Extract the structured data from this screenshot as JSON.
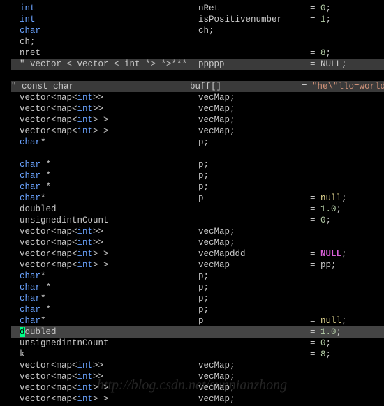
{
  "watermark": "http://blog.csdn.net/sunnianzhong",
  "code_lines": [
    {
      "decl_type": "int",
      "decl_rest": "",
      "var": "nRet",
      "assign": true,
      "val": "0",
      "val_kind": "num",
      "hl": false
    },
    {
      "decl_type": "int",
      "decl_rest": "",
      "var": "isPositivenumber",
      "assign": true,
      "val": "1",
      "val_kind": "num",
      "hl": false
    },
    {
      "decl_type": "char",
      "decl_rest": "",
      "var": "ch;",
      "assign": false,
      "val": "",
      "val_kind": "",
      "hl": false
    },
    {
      "decl_type": "",
      "decl_rest": "ch;",
      "var": "",
      "assign": false,
      "val": "",
      "val_kind": "",
      "hl": false
    },
    {
      "decl_type": "",
      "decl_rest": "nret",
      "var": "",
      "assign": true,
      "val": "8",
      "val_kind": "num",
      "hl": false,
      "no_var_col": true
    },
    {
      "decl_type": "",
      "decl_rest": "\" vector < vector < int *> *>***",
      "var": "ppppp",
      "assign": true,
      "val": "NULL",
      "val_kind": "plain",
      "hl": true
    },
    {
      "blank": true
    },
    {
      "decl_type": "",
      "decl_rest": "\" const char",
      "var": "buff[]",
      "assign": true,
      "val": "\"he\\\"llo=world\"",
      "val_kind": "str",
      "hl": true
    },
    {
      "decl_type": "",
      "decl_rest": "vector<map<int>>",
      "inner_kw": "int",
      "var": "vecMap;",
      "assign": false,
      "val": "",
      "val_kind": "",
      "hl": false
    },
    {
      "decl_type": "",
      "decl_rest": "vector<map<int>>",
      "inner_kw": "int",
      "var": "vecMap;",
      "assign": false,
      "val": "",
      "val_kind": "",
      "hl": false
    },
    {
      "decl_type": "",
      "decl_rest": "vector<map<int> >",
      "inner_kw": "int",
      "var": "vecMap;",
      "assign": false,
      "val": "",
      "val_kind": "",
      "hl": false
    },
    {
      "decl_type": "",
      "decl_rest": "vector<map<int> >",
      "inner_kw": "int",
      "var": "vecMap;",
      "assign": false,
      "val": "",
      "val_kind": "",
      "hl": false
    },
    {
      "decl_type": "char",
      "decl_rest": "*",
      "var": "p;",
      "assign": false,
      "val": "",
      "val_kind": "",
      "hl": false
    },
    {
      "blank": true
    },
    {
      "decl_type": "char",
      "decl_rest": " *",
      "var": "p;",
      "assign": false,
      "val": "",
      "val_kind": "",
      "hl": false
    },
    {
      "decl_type": "char",
      "decl_rest": " *",
      "var": "p;",
      "assign": false,
      "val": "",
      "val_kind": "",
      "hl": false
    },
    {
      "decl_type": "char",
      "decl_rest": " *",
      "var": "p;",
      "assign": false,
      "val": "",
      "val_kind": "",
      "hl": false
    },
    {
      "decl_type": "char",
      "decl_rest": "*",
      "var": "p",
      "assign": true,
      "val": "null",
      "val_kind": "null",
      "hl": false
    },
    {
      "decl_type": "",
      "decl_rest": "doubled",
      "var": "",
      "assign": true,
      "val": "1.0",
      "val_kind": "num",
      "hl": false,
      "no_var_col": true
    },
    {
      "decl_type": "",
      "decl_rest": "unsignedintnCount",
      "var": "",
      "assign": true,
      "val": "0",
      "val_kind": "num",
      "hl": false,
      "no_var_col": true
    },
    {
      "decl_type": "",
      "decl_rest": "vector<map<int>>",
      "inner_kw": "int",
      "var": "vecMap;",
      "assign": false,
      "val": "",
      "val_kind": "",
      "hl": false
    },
    {
      "decl_type": "",
      "decl_rest": "vector<map<int>>",
      "inner_kw": "int",
      "var": "vecMap;",
      "assign": false,
      "val": "",
      "val_kind": "",
      "hl": false
    },
    {
      "decl_type": "",
      "decl_rest": "vector<map<int> >",
      "inner_kw": "int",
      "var": "vecMapddd",
      "assign": true,
      "val": "NULL",
      "val_kind": "NULL",
      "hl": false
    },
    {
      "decl_type": "",
      "decl_rest": "vector<map<int> >",
      "inner_kw": "int",
      "var": "vecMap",
      "assign": true,
      "val": "pp",
      "val_kind": "plain",
      "hl": false
    },
    {
      "decl_type": "char",
      "decl_rest": "*",
      "var": "p;",
      "assign": false,
      "val": "",
      "val_kind": "",
      "hl": false
    },
    {
      "decl_type": "char",
      "decl_rest": " *",
      "var": "p;",
      "assign": false,
      "val": "",
      "val_kind": "",
      "hl": false
    },
    {
      "decl_type": "char",
      "decl_rest": "*",
      "var": "p;",
      "assign": false,
      "val": "",
      "val_kind": "",
      "hl": false
    },
    {
      "decl_type": "char",
      "decl_rest": " *",
      "var": "p;",
      "assign": false,
      "val": "",
      "val_kind": "",
      "hl": false
    },
    {
      "decl_type": "char",
      "decl_rest": "*",
      "var": "p",
      "assign": true,
      "val": "null",
      "val_kind": "null",
      "hl": false
    },
    {
      "decl_type": "",
      "decl_rest": "doubled",
      "var": "",
      "assign": true,
      "val": "1.0",
      "val_kind": "num",
      "hl": true,
      "cursor_d": true,
      "no_var_col": true,
      "current": true
    },
    {
      "decl_type": "",
      "decl_rest": "unsignedintnCount",
      "var": "",
      "assign": true,
      "val": "0",
      "val_kind": "num",
      "hl": false,
      "no_var_col": true
    },
    {
      "decl_type": "",
      "decl_rest": "k",
      "var": "",
      "assign": true,
      "val": "8",
      "val_kind": "num",
      "hl": false,
      "no_var_col": true
    },
    {
      "decl_type": "",
      "decl_rest": "vector<map<int>>",
      "inner_kw": "int",
      "var": "vecMap;",
      "assign": false,
      "val": "",
      "val_kind": "",
      "hl": false
    },
    {
      "decl_type": "",
      "decl_rest": "vector<map<int>>",
      "inner_kw": "int",
      "var": "vecMap;",
      "assign": false,
      "val": "",
      "val_kind": "",
      "hl": false
    },
    {
      "decl_type": "",
      "decl_rest": "vector<map<int> >",
      "inner_kw": "int",
      "var": "vecMap;",
      "assign": false,
      "val": "",
      "val_kind": "",
      "hl": false
    },
    {
      "decl_type": "",
      "decl_rest": "vector<map<int> >",
      "inner_kw": "int",
      "var": "vecMap;",
      "assign": false,
      "val": "",
      "val_kind": "",
      "hl": false
    }
  ]
}
